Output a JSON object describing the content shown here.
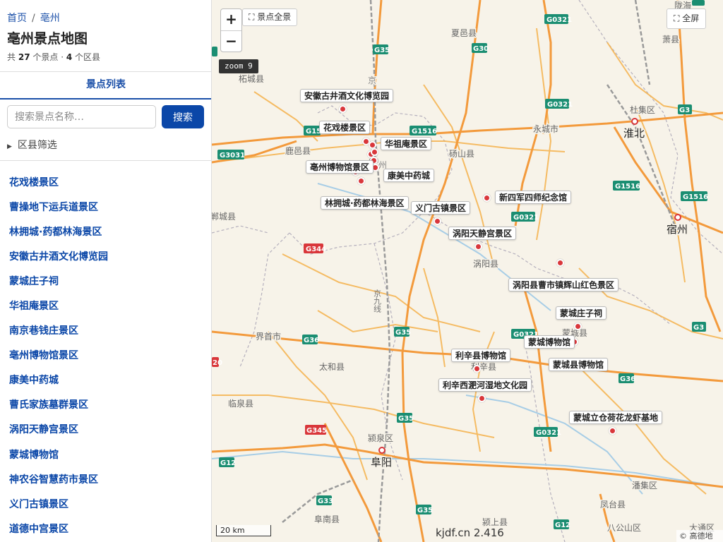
{
  "breadcrumb": {
    "home": "首页",
    "separator": "/",
    "current": "亳州"
  },
  "page_title": "亳州景点地图",
  "summary": {
    "prefix": "共",
    "spot_count": "27",
    "mid": "个景点 ·",
    "district_count": "4",
    "suffix": "个区县"
  },
  "tabs": [
    {
      "label": "景点列表"
    }
  ],
  "search": {
    "placeholder": "搜索景点名称…",
    "button_label": "搜索"
  },
  "filter": {
    "label": "区县筛选"
  },
  "spots": [
    "花戏楼景区",
    "曹操地下运兵道景区",
    "林拥城·药都林海景区",
    "安徽古井酒文化博览园",
    "蒙城庄子祠",
    "华祖庵景区",
    "南京巷钱庄景区",
    "亳州博物馆景区",
    "康美中药城",
    "曹氏家族墓群景区",
    "涡阳天静宫景区",
    "蒙城博物馆",
    "神农谷智慧药市景区",
    "义门古镇景区",
    "道德中宫景区"
  ],
  "map": {
    "controls": {
      "zoom_in": "+",
      "zoom_out": "−",
      "overview": "景点全景",
      "fullscreen": "全屏",
      "zoom_level": "zoom 9"
    },
    "scale": "20 km",
    "footer": "kjdf.cn 2.416",
    "attribution": "© 高德地图",
    "colors": {
      "marker": "#d9373b",
      "highway": "#f39a3c",
      "road": "#f5b24c",
      "rail": "#9a9a9a",
      "shield": "#1b8e72",
      "water": "#a7cde6"
    },
    "tooltips": [
      "安徽古井酒文化博览园",
      "花戏楼景区",
      "华祖庵景区",
      "亳州博物馆景区",
      "康美中药城",
      "林拥城·药都林海景区",
      "义门古镇景区",
      "新四军四师纪念馆",
      "涡阳天静宫景区",
      "涡阳县曹市镇辉山红色景区",
      "蒙城庄子祠",
      "蒙城博物馆",
      "利辛县博物馆",
      "蒙城县博物馆",
      "利辛西淝河湿地文化园",
      "蒙城立仓荷花龙虾基地"
    ],
    "base_labels": {
      "cities": [
        "淮北",
        "宿州",
        "阜阳",
        "亳州"
      ],
      "places": [
        "柘城县",
        "夏邑县",
        "萧县",
        "杜集区",
        "永城市",
        "砀山县",
        "鹿邑县",
        "郸城县",
        "太和县",
        "界首市",
        "临泉县",
        "颍泉区",
        "阜南县",
        "颍上县",
        "凤台县",
        "潘集区",
        "八公山区",
        "涡阳县",
        "蒙城县",
        "利辛县",
        "大通区"
      ],
      "road_shields": [
        "G0321",
        "G35",
        "G30",
        "G15",
        "G1516",
        "G3031",
        "G344",
        "G36",
        "G345",
        "G12",
        "G33",
        "G3",
        "G35"
      ],
      "rail_label": "京九线",
      "partial_labels": [
        "陇海",
        "G3",
        "20"
      ]
    }
  }
}
